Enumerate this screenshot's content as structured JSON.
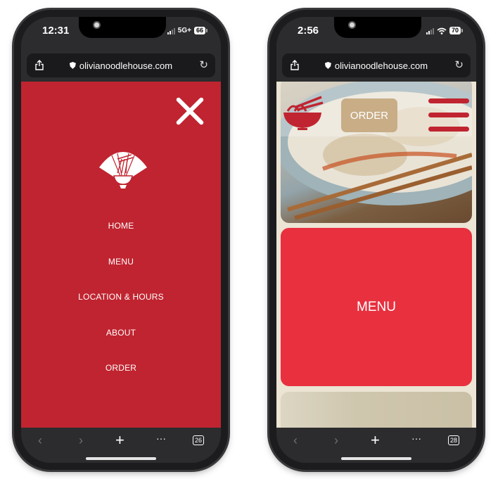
{
  "phones": [
    {
      "status": {
        "time": "12:31",
        "network": "5G+",
        "battery": "66"
      },
      "browser": {
        "url": "olivianoodlehouse.com",
        "tab_count": "26"
      },
      "menu_overlay": {
        "items": [
          {
            "label": "HOME"
          },
          {
            "label": "MENU"
          },
          {
            "label": "LOCATION & HOURS"
          },
          {
            "label": "ABOUT"
          },
          {
            "label": "ORDER"
          }
        ]
      }
    },
    {
      "status": {
        "time": "2:56",
        "network": "wifi",
        "battery": "70"
      },
      "browser": {
        "url": "olivianoodlehouse.com",
        "tab_count": "28"
      },
      "site": {
        "order_button": "ORDER",
        "menu_card": "MENU"
      }
    }
  ],
  "toolbar": {
    "back_icon": "‹",
    "forward_icon": "›",
    "new_tab_icon": "+",
    "more_icon": "···",
    "reload_icon": "↻"
  },
  "colors": {
    "menu_red": "#c02430",
    "card_red": "#e8303f",
    "order_tan": "#c8ad86",
    "cream": "#ece4d4"
  }
}
